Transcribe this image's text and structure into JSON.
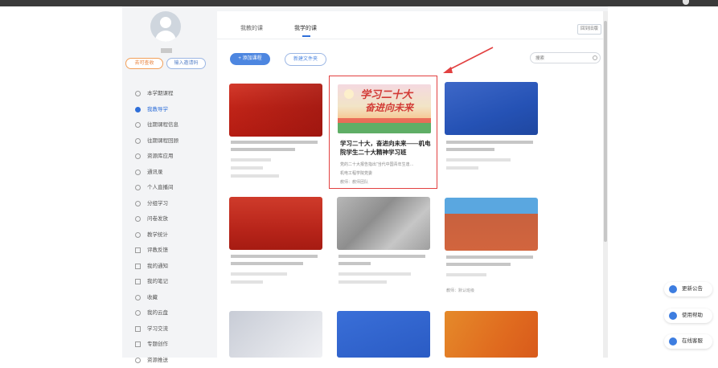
{
  "sidebar": {
    "btn_edit": "去可查收",
    "btn_join": "输入邀请码",
    "items": [
      {
        "label": "本学期课程",
        "icon": "dot"
      },
      {
        "label": "我教导学",
        "icon": "dot",
        "active": true
      },
      {
        "label": "往期课程信息",
        "icon": "dot"
      },
      {
        "label": "往期课程回顾",
        "icon": "dot"
      },
      {
        "label": "资源库应用",
        "icon": "dot"
      },
      {
        "label": "通讯录",
        "icon": "people"
      },
      {
        "label": "个人直播间",
        "icon": "dot"
      },
      {
        "label": "分组学习",
        "icon": "dot"
      },
      {
        "label": "问卷发放",
        "icon": "dot"
      },
      {
        "label": "教学统计",
        "icon": "dot"
      },
      {
        "label": "评教反馈",
        "icon": "sq"
      },
      {
        "label": "我的通知",
        "icon": "sq"
      },
      {
        "label": "我的笔记",
        "icon": "sq"
      },
      {
        "label": "收藏",
        "icon": "heart"
      },
      {
        "label": "我的云盘",
        "icon": "cloud"
      },
      {
        "label": "学习交流",
        "icon": "sq"
      },
      {
        "label": "专题创作",
        "icon": "sq"
      },
      {
        "label": "资源推送",
        "icon": "dot"
      }
    ]
  },
  "main": {
    "tabs": [
      "我教的课",
      "我学的课"
    ],
    "active_tab": 1,
    "back_label": "回到旧版",
    "add_course": "+ 添加课程",
    "new_folder": "新建文件夹",
    "search_placeholder": "搜索"
  },
  "featured_course": {
    "title": "学习二十大，奋进向未来——机电院学生二十大精神学习班",
    "desc": "党的二十大报告指出“当代中国青年生逢…",
    "org": "机电工程学院党委",
    "team": "教师：教师团队",
    "image_heading_line1": "学习二十大",
    "image_heading_line2": "奋进向未来"
  },
  "cards": {
    "team_label": "教师：默认班级"
  },
  "right_float": {
    "update": "更新公告",
    "help": "使用帮助",
    "service": "在线客服"
  },
  "colors": {
    "accent": "#2f6fd9",
    "highlight_border": "#e24040",
    "arrow": "#e24040"
  }
}
